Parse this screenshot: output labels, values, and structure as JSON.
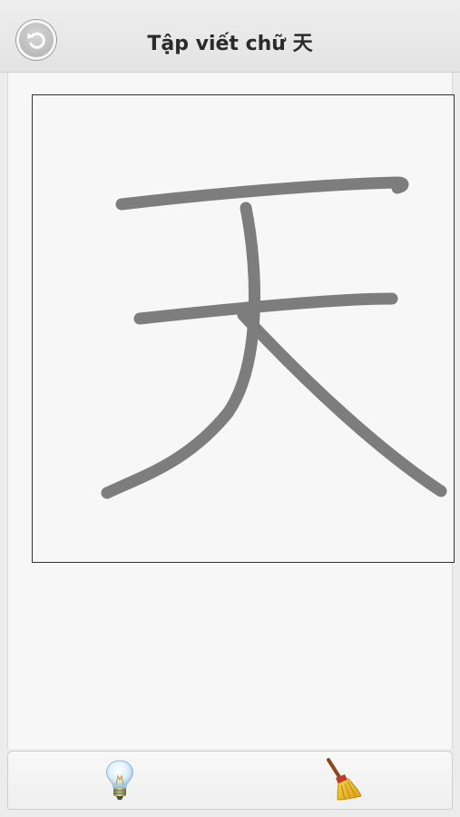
{
  "header": {
    "title": "Tập viết chữ 天",
    "back_icon": "undo-arrow-icon"
  },
  "canvas": {
    "character": "天",
    "stroke_color": "#7d7d7d",
    "border_color": "#333333"
  },
  "toolbar": {
    "hint_icon": "lightbulb-icon",
    "clear_icon": "broom-icon"
  }
}
